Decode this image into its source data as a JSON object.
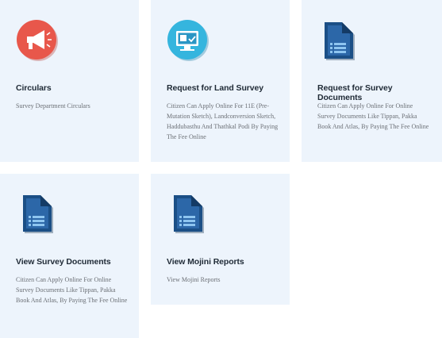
{
  "cards": [
    {
      "title": "Circulars",
      "description": "Survey Department Circulars",
      "icon": "megaphone-icon"
    },
    {
      "title": "Request for Land Survey",
      "description": "Citizen Can Apply Online For 11E (Pre-Mutation Sketch), Landconversion Sketch, Haddubasthu And Thathkal Podi By Paying The Fee Online",
      "icon": "monitor-icon"
    },
    {
      "title": "Request for Survey Documents",
      "description": "Citizen Can Apply Online For Online Survey Documents Like Tippan, Pakka Book And Atlas, By Paying The Fee Online",
      "icon": "document-icon"
    },
    {
      "title": "View Survey Documents",
      "description": "Citizen Can Apply Online For Online Survey Documents Like Tippan, Pakka Book And Atlas, By Paying The Fee Online",
      "icon": "document-icon"
    },
    {
      "title": "View Mojini Reports",
      "description": "View Mojini Reports",
      "icon": "document-icon"
    }
  ]
}
